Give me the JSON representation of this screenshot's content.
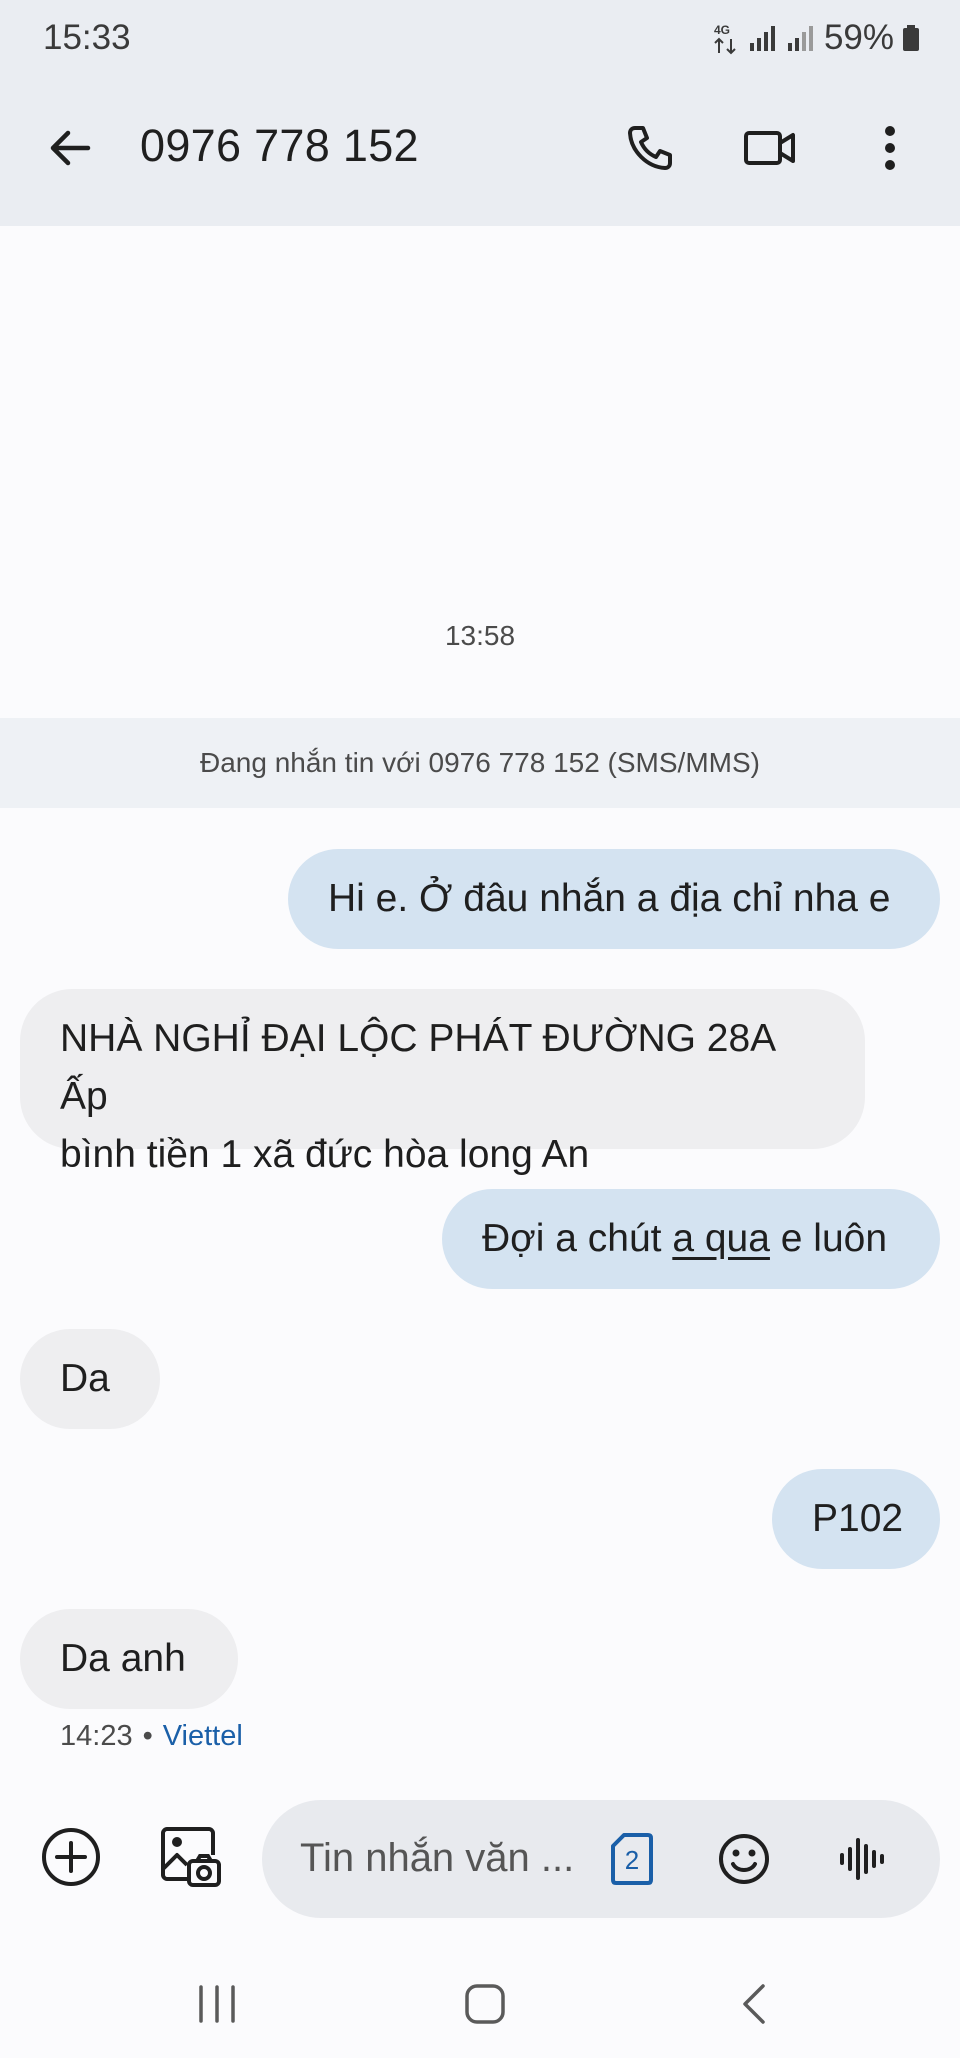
{
  "status_bar": {
    "time": "15:33",
    "network": "4G",
    "battery": "59%"
  },
  "header": {
    "title": "0976 778 152",
    "icons": [
      "back-arrow-icon",
      "phone-icon",
      "video-camera-icon",
      "more-vert-icon"
    ]
  },
  "conversation": {
    "timestamp": "13:58",
    "banner": "Đang nhắn tin với 0976 778 152 (SMS/MMS)",
    "messages": [
      {
        "direction": "outgoing",
        "text": "Hi e. Ở đâu nhắn a địa chỉ nha e"
      },
      {
        "direction": "incoming",
        "line1": "NHÀ NGHỈ ĐẠI LỘC PHÁT ĐƯỜNG 28A Ấp",
        "line2": "bình tiền 1 xã đức hòa long An"
      },
      {
        "direction": "outgoing",
        "before": "Đợi a chút ",
        "underlined": "a qua",
        "after": " e luôn"
      },
      {
        "direction": "incoming",
        "text": "Da"
      },
      {
        "direction": "outgoing",
        "text": "P102"
      },
      {
        "direction": "incoming",
        "text": "Da anh"
      }
    ],
    "last_time": "14:23",
    "separator": "•",
    "carrier": "Viettel"
  },
  "compose": {
    "placeholder": "Tin nhắn văn ...",
    "sim_number": "2"
  },
  "colors": {
    "outgoing_bubble": "#d4e3f1",
    "incoming_bubble": "#eeeef0",
    "header_bg": "#eaedf2",
    "link": "#1a5fa8"
  }
}
